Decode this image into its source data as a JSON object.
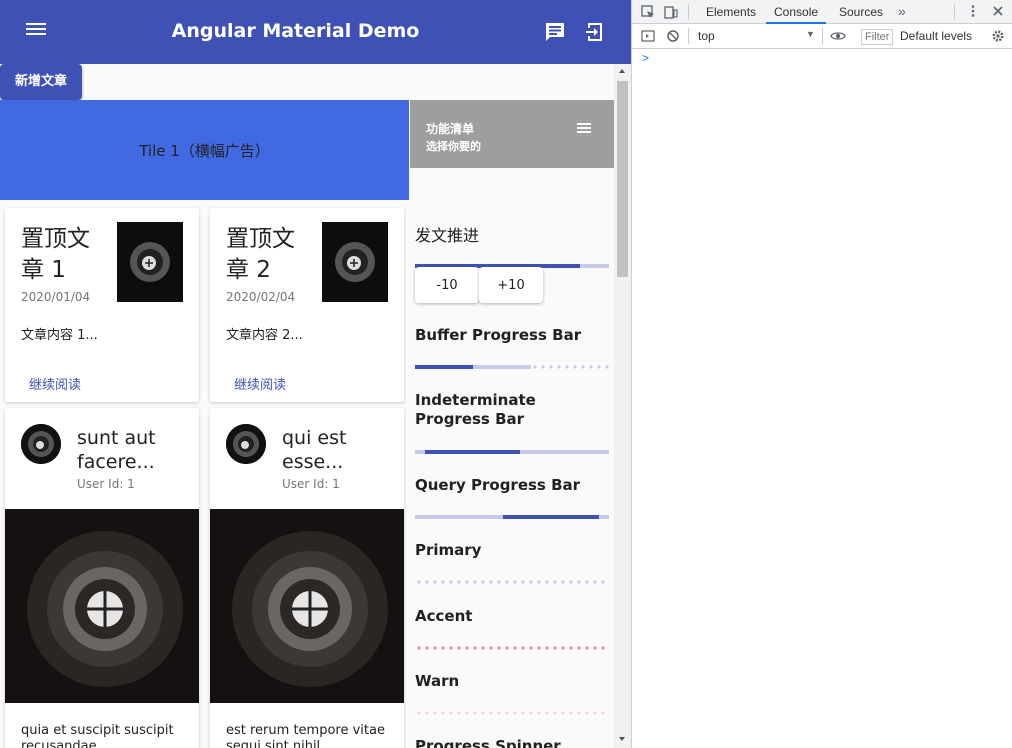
{
  "app": {
    "title": "Angular Material Demo",
    "add_button": "新增文章",
    "banner": "Tile 1（横幅广告）",
    "side_header": {
      "title": "功能清单",
      "subtitle": "选择你要的"
    }
  },
  "posts": [
    {
      "title": "置顶文章 1",
      "date": "2020/01/04",
      "body": "文章内容 1...",
      "link": "继续阅读"
    },
    {
      "title": "置顶文章 2",
      "date": "2020/02/04",
      "body": "文章内容 2...",
      "link": "继续阅读"
    }
  ],
  "users": [
    {
      "title": "sunt aut facere...",
      "sub": "User Id: 1",
      "body": "quia et suscipit suscipit recusandae consequuntur"
    },
    {
      "title": "qui est esse...",
      "sub": "User Id: 1",
      "body": "est rerum tempore vitae sequi sint nihil"
    }
  ],
  "side": {
    "publish_title": "发文推进",
    "publish_progress": 0.85,
    "minus_label": "-10",
    "plus_label": "+10",
    "buffer_title": "Buffer Progress Bar",
    "indeterminate_title": "Indeterminate Progress Bar",
    "query_title": "Query Progress Bar",
    "primary_title": "Primary",
    "accent_title": "Accent",
    "warn_title": "Warn",
    "spinner_title": "Progress Spinner"
  },
  "devtools": {
    "tabs": [
      "Elements",
      "Console",
      "Sources"
    ],
    "active_tab": "Console",
    "context": "top",
    "filter_placeholder": "Filter",
    "levels": "Default levels",
    "prompt": ">"
  },
  "colors": {
    "primary": "#3f51b5",
    "banner": "#4169e1",
    "accent": "#ff4081",
    "warn": "#f44336"
  }
}
